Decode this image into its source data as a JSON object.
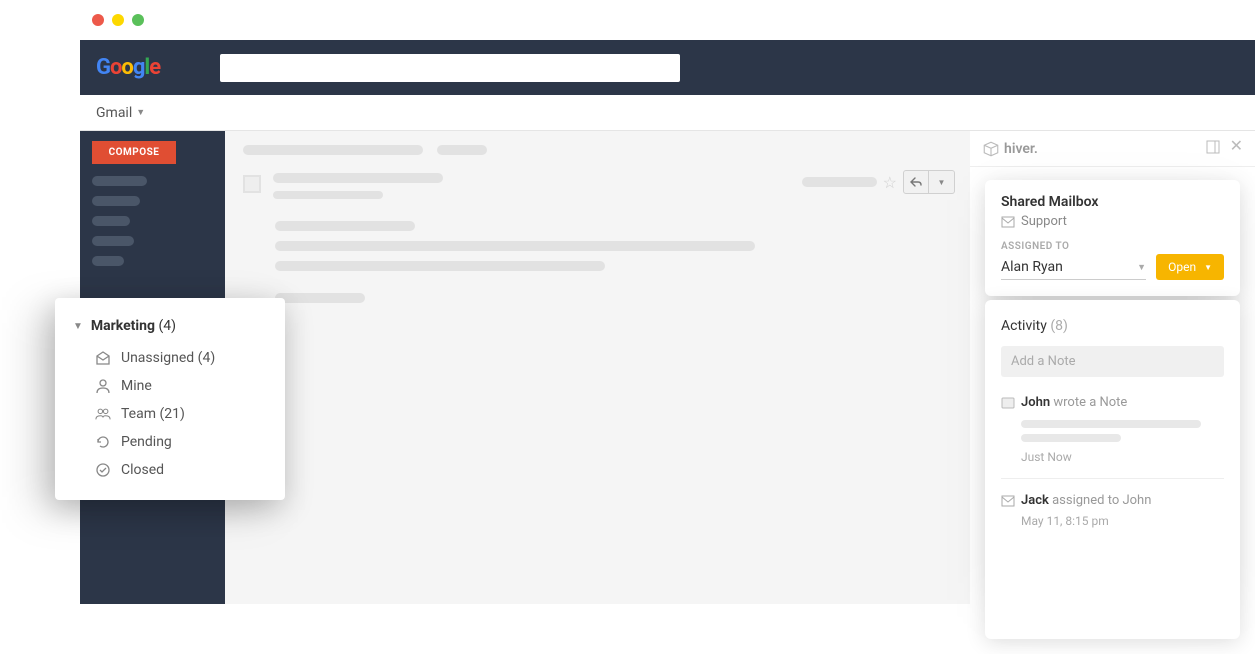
{
  "chrome": {
    "traffic_lights": [
      "red",
      "yellow",
      "green"
    ]
  },
  "header": {
    "logo": "Google",
    "search_placeholder": ""
  },
  "subheader": {
    "service": "Gmail"
  },
  "sidebar": {
    "compose": "COMPOSE"
  },
  "mailbox_popup": {
    "title": "Marketing",
    "count": "(4)",
    "items": [
      {
        "label": "Unassigned (4)",
        "icon": "mail-open"
      },
      {
        "label": "Mine",
        "icon": "user"
      },
      {
        "label": "Team (21)",
        "icon": "users"
      },
      {
        "label": "Pending",
        "icon": "refresh"
      },
      {
        "label": "Closed",
        "icon": "check-circle"
      }
    ]
  },
  "hiver_header": {
    "brand": "hiver."
  },
  "hiver_panel1": {
    "title": "Shared Mailbox",
    "subtitle": "Support",
    "assigned_label": "ASSIGNED TO",
    "assignee": "Alan Ryan",
    "status_btn": "Open"
  },
  "hiver_panel2": {
    "title": "Activity",
    "count": "(8)",
    "add_note_placeholder": "Add a Note",
    "items": [
      {
        "actor": "John",
        "action": "wrote a Note",
        "time": "Just Now",
        "type": "note"
      },
      {
        "actor": "Jack",
        "action": "assigned to John",
        "time": "May 11, 8:15 pm",
        "type": "assign"
      }
    ]
  }
}
